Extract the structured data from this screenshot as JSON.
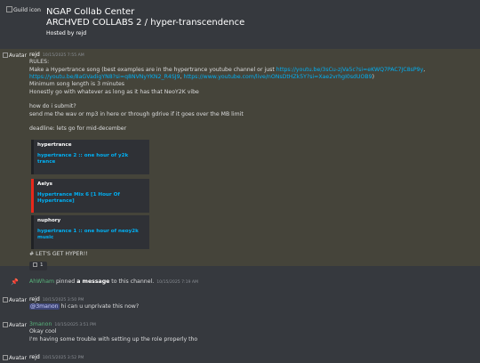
{
  "header": {
    "guild_icon_alt": "Guild icon",
    "guild_name": "NGAP Collab Center",
    "channel_path": "ARCHVED COLLABS 2 / hyper-transcendence",
    "hosted_by": "Hosted by rejd"
  },
  "messages": [
    {
      "avatar_alt": "Avatar",
      "author": "rejd",
      "timestamp": "10/15/2025 7:55 AM",
      "lines": {
        "l1": "RULES:",
        "l2a": "Make a Hypertrance song (best examples are in the hypertrance youtube channel or just ",
        "link1": "https://youtu.be/3sCu-zjVa5c?si=eKWQ7PAC7JC8sP9y",
        "comma1": ",",
        "link2": "https://youtu.be/8aGVadigYN8?si=q8NVNyYKN2_R4SJ9",
        "comma2": ", ",
        "link3": "https://www.youtube.com/live/nONsDtHZk5Y?si=Xae2vrhgI0sdUOB9",
        "close": ")",
        "l3": "Minimum song length is 3 minutes",
        "l4": "Honestly go with whatever as long as it has that NeoY2K vibe",
        "l5": "how do i submit?",
        "l6": "send me the wav or mp3 in here or through gdrive if it goes over the MB limit",
        "l7": "deadline: lets go for mid-december"
      },
      "embeds": [
        {
          "title": "hypertrance",
          "desc": "hypertrance 2 :: one hour of y2k trance"
        },
        {
          "title": "Aelys",
          "desc": "Hypertrance Mix 6 [1 Hour Of Hypertrance]"
        },
        {
          "title": "nuphory",
          "desc": "hypertrance 1 :: one hour of neoy2k music"
        }
      ],
      "after_text": "# LET'S GET HYPER!!",
      "reaction": {
        "emoji_alt": "",
        "count": "1"
      }
    },
    {
      "author": "AhWham",
      "pre": " pinned ",
      "bold1": "a message",
      "mid": " to this channel.",
      "timestamp": "10/15/2025 7:19 AM"
    },
    {
      "avatar_alt": "Avatar",
      "author": "rejd",
      "timestamp": "10/15/2025 3:50 PM",
      "mention": "@3manon",
      "text": " hi can u unprivate this now?"
    },
    {
      "avatar_alt": "Avatar",
      "author": "3manon",
      "timestamp": "10/15/2025 3:51 PM",
      "text1": "Okay cool",
      "text2": "I'm having some trouble with setting up the role properly tho"
    },
    {
      "avatar_alt": "Avatar",
      "author": "rejd",
      "timestamp": "10/15/2025 3:52 PM"
    }
  ]
}
